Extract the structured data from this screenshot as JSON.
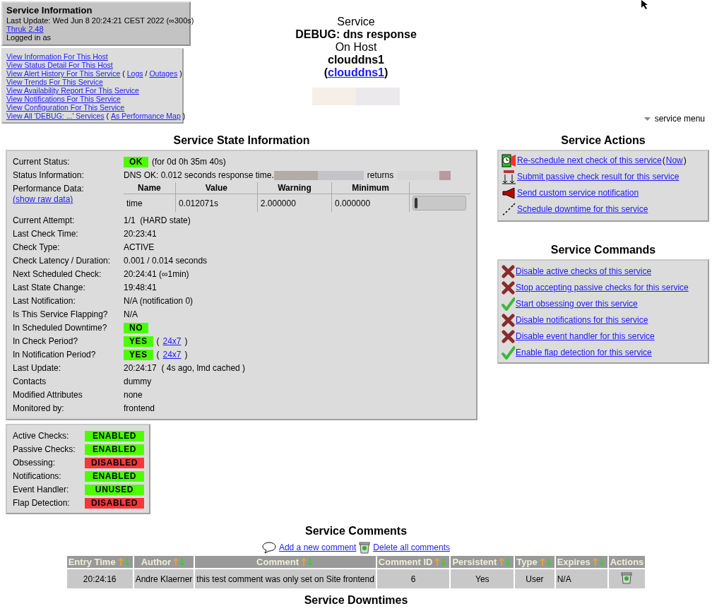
{
  "header": {
    "title": "Service Information",
    "last_update": "Last Update: Wed Jun 8 20:24:21 CEST 2022 (∞300s)",
    "version_link": "Thruk 2.48",
    "logged_in": "Logged in as"
  },
  "nav_links": [
    [
      {
        "kind": "link",
        "text": "View Information For This Host"
      }
    ],
    [
      {
        "kind": "link",
        "text": "View Status Detail For This Host"
      }
    ],
    [
      {
        "kind": "link",
        "text": "View Alert History For This Service"
      },
      {
        "kind": "text",
        "text": "("
      },
      {
        "kind": "link",
        "text": "Logs"
      },
      {
        "kind": "text",
        "text": "/"
      },
      {
        "kind": "link",
        "text": "Outages"
      },
      {
        "kind": "text",
        "text": ")"
      }
    ],
    [
      {
        "kind": "link",
        "text": "View Trends For This Service"
      }
    ],
    [
      {
        "kind": "link",
        "text": "View Availability Report For This Service"
      }
    ],
    [
      {
        "kind": "link",
        "text": "View Notifications For This Service"
      }
    ],
    [
      {
        "kind": "link",
        "text": "View Configuration For This Service"
      }
    ],
    [
      {
        "kind": "link",
        "text": "View All 'DEBUG: ...' Services"
      },
      {
        "kind": "text",
        "text": "("
      },
      {
        "kind": "link",
        "text": "As Performance Map"
      },
      {
        "kind": "text",
        "text": ")"
      }
    ]
  ],
  "title": {
    "line1": "Service",
    "service": "DEBUG: dns response",
    "line3": "On Host",
    "host": "clouddns1",
    "host_link": [
      {
        "kind": "text",
        "text": "("
      },
      {
        "kind": "link",
        "text": "clouddns1"
      },
      {
        "kind": "text",
        "text": ")"
      }
    ]
  },
  "service_menu": "service menu",
  "state_info": {
    "title": "Service State Information",
    "rows": [
      {
        "kind": "badge",
        "label": "Current Status:",
        "badge": {
          "text": "OK",
          "color": "#4cff00"
        },
        "segments": [
          {
            "kind": "text",
            "text": "(for 0d 0h 35m 40s)"
          }
        ]
      },
      {
        "kind": "status_info",
        "label": "Status Information:",
        "value": "DNS OK: 0.012 seconds response time.",
        "middle": "returns"
      },
      {
        "kind": "perf",
        "label": "Performance Data:",
        "link": "(show raw data)",
        "columns": [
          "Name",
          "Value",
          "Warning",
          "Minimum"
        ],
        "row": {
          "name": "time",
          "value": "0.012071s",
          "warning": "2.000000",
          "minimum": "0.000000",
          "level": 0.006
        }
      },
      {
        "kind": "text",
        "label": "Current Attempt:",
        "value": "1/1  (HARD state)"
      },
      {
        "kind": "text",
        "label": "Last Check Time:",
        "value": "20:23:41"
      },
      {
        "kind": "text",
        "label": "Check Type:",
        "value": "ACTIVE"
      },
      {
        "kind": "text",
        "label": "Check Latency / Duration:",
        "value": "0.001 / 0.014 seconds"
      },
      {
        "kind": "text",
        "label": "Next Scheduled Check:",
        "value": "20:24:41 (∞1min)"
      },
      {
        "kind": "text",
        "label": "Last State Change:",
        "value": "19:48:41"
      },
      {
        "kind": "text",
        "label": "Last Notification:",
        "value": "N/A (notification 0)"
      },
      {
        "kind": "text",
        "label": "Is This Service Flapping?",
        "value": "N/A"
      },
      {
        "kind": "badge",
        "label": "In Scheduled Downtime?",
        "badge": {
          "text": "NO",
          "color": "#4cff00"
        },
        "segments": []
      },
      {
        "kind": "badge",
        "label": "In Check Period?",
        "badge": {
          "text": "YES",
          "color": "#4cff00"
        },
        "segments": [
          {
            "kind": "text",
            "text": "("
          },
          {
            "kind": "link",
            "text": "24x7"
          },
          {
            "kind": "text",
            "text": ")"
          }
        ]
      },
      {
        "kind": "badge",
        "label": "In Notification Period?",
        "badge": {
          "text": "YES",
          "color": "#4cff00"
        },
        "segments": [
          {
            "kind": "text",
            "text": "("
          },
          {
            "kind": "link",
            "text": "24x7"
          },
          {
            "kind": "text",
            "text": ")"
          }
        ]
      },
      {
        "kind": "text",
        "label": "Last Update:",
        "value": "20:24:17  ( 4s ago, lmd cached )"
      },
      {
        "kind": "text",
        "label": "Contacts",
        "value": "dummy"
      },
      {
        "kind": "text",
        "label": "Modified Attributes",
        "value": "none"
      },
      {
        "kind": "text",
        "label": "Monitored by:",
        "value": "frontend"
      }
    ]
  },
  "flags": [
    {
      "label": "Active Checks:",
      "value": "ENABLED",
      "color": "#4cff00"
    },
    {
      "label": "Passive Checks:",
      "value": "ENABLED",
      "color": "#4cff00"
    },
    {
      "label": "Obsessing:",
      "value": "DISABLED",
      "color": "#f83838"
    },
    {
      "label": "Notifications:",
      "value": "ENABLED",
      "color": "#4cff00"
    },
    {
      "label": "Event Handler:",
      "value": "UNUSED",
      "color": "#4cff00"
    },
    {
      "label": "Flap Detection:",
      "value": "DISABLED",
      "color": "#f83838"
    }
  ],
  "actions": {
    "title": "Service Actions",
    "items": [
      {
        "kind": "reschedule",
        "segments": [
          {
            "kind": "link",
            "text": "Re-schedule next check of this service"
          },
          {
            "kind": "text",
            "text": "("
          },
          {
            "kind": "link",
            "text": "Now"
          },
          {
            "kind": "text",
            "text": ")"
          }
        ]
      },
      {
        "kind": "passive",
        "segments": [
          {
            "kind": "link",
            "text": "Submit passive check result for this service"
          }
        ]
      },
      {
        "kind": "notify",
        "segments": [
          {
            "kind": "link",
            "text": "Send custom service notification"
          }
        ]
      },
      {
        "kind": "downtime",
        "segments": [
          {
            "kind": "link",
            "text": "Schedule downtime for this service"
          }
        ]
      }
    ]
  },
  "commands": {
    "title": "Service Commands",
    "items": [
      {
        "kind": "disable",
        "text": "Disable active checks of this service"
      },
      {
        "kind": "disable",
        "text": "Stop accepting passive checks for this service"
      },
      {
        "kind": "enable",
        "text": "Start obsessing over this service"
      },
      {
        "kind": "disable",
        "text": "Disable notifications for this service"
      },
      {
        "kind": "disable",
        "text": "Disable event handler for this service"
      },
      {
        "kind": "enable",
        "text": "Enable flap detection for this service"
      }
    ]
  },
  "comments": {
    "title": "Service Comments",
    "add_link": "Add a new comment",
    "delete_link": "Delete all comments",
    "columns": [
      {
        "label": "Entry Time",
        "sortable": true
      },
      {
        "label": "Author",
        "sortable": true
      },
      {
        "label": "Comment",
        "sortable": true
      },
      {
        "label": "Comment ID",
        "sortable": true
      },
      {
        "label": "Persistent",
        "sortable": true
      },
      {
        "label": "Type",
        "sortable": true
      },
      {
        "label": "Expires",
        "sortable": true
      },
      {
        "label": "Actions",
        "sortable": false
      }
    ],
    "rows": [
      {
        "entry_time": "20:24:16",
        "author": "Andre Klaerner",
        "comment": "this test comment was only set on Site frontend",
        "comment_id": "6",
        "persistent": "Yes",
        "type": "User",
        "expires": "N/A"
      }
    ]
  },
  "downtimes": {
    "title": "Service Downtimes"
  }
}
